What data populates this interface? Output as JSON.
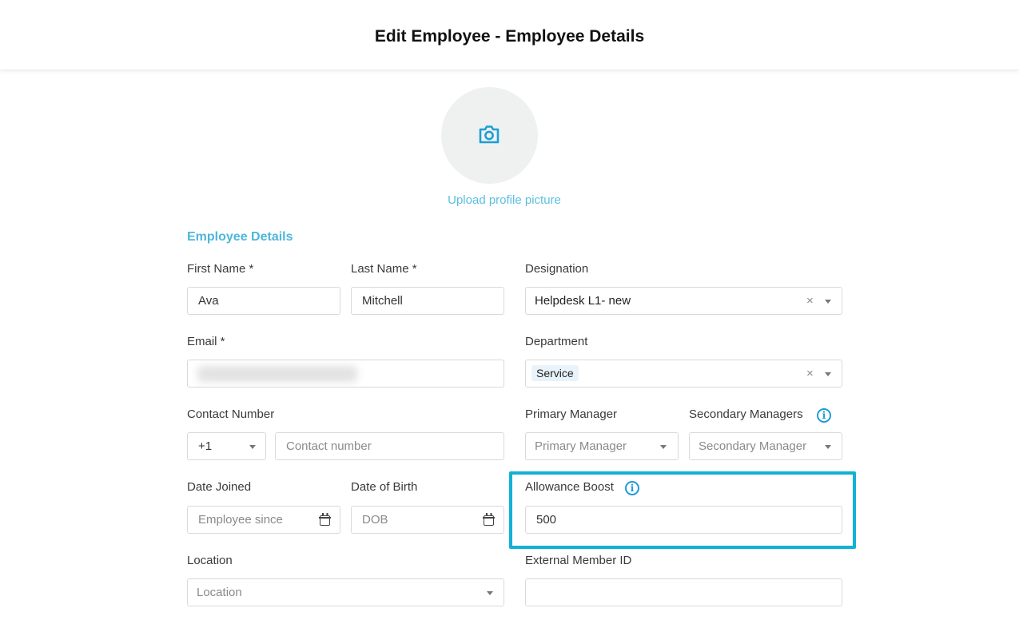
{
  "header": {
    "title": "Edit Employee - Employee Details"
  },
  "profile": {
    "upload_label": "Upload profile picture",
    "icon": "camera-icon"
  },
  "section": {
    "title": "Employee Details"
  },
  "fields": {
    "first_name": {
      "label": "First Name *",
      "value": "Ava"
    },
    "last_name": {
      "label": "Last Name *",
      "value": "Mitchell"
    },
    "designation": {
      "label": "Designation",
      "value": "Helpdesk L1- new"
    },
    "email": {
      "label": "Email *"
    },
    "department": {
      "label": "Department",
      "value": "Service"
    },
    "contact_number": {
      "label": "Contact Number",
      "country_code": "+1",
      "placeholder": "Contact number"
    },
    "primary_manager": {
      "label": "Primary Manager",
      "placeholder": "Primary Manager"
    },
    "secondary_managers": {
      "label": "Secondary Managers",
      "placeholder": "Secondary Manager"
    },
    "date_joined": {
      "label": "Date Joined",
      "placeholder": "Employee since"
    },
    "date_of_birth": {
      "label": "Date of Birth",
      "placeholder": "DOB"
    },
    "allowance_boost": {
      "label": "Allowance Boost",
      "value": "500"
    },
    "location": {
      "label": "Location",
      "placeholder": "Location"
    },
    "external_member_id": {
      "label": "External Member ID",
      "value": ""
    }
  },
  "colors": {
    "accent": "#4fb6dc",
    "highlight": "#12b1d6",
    "info_icon": "#1e9bd7"
  }
}
